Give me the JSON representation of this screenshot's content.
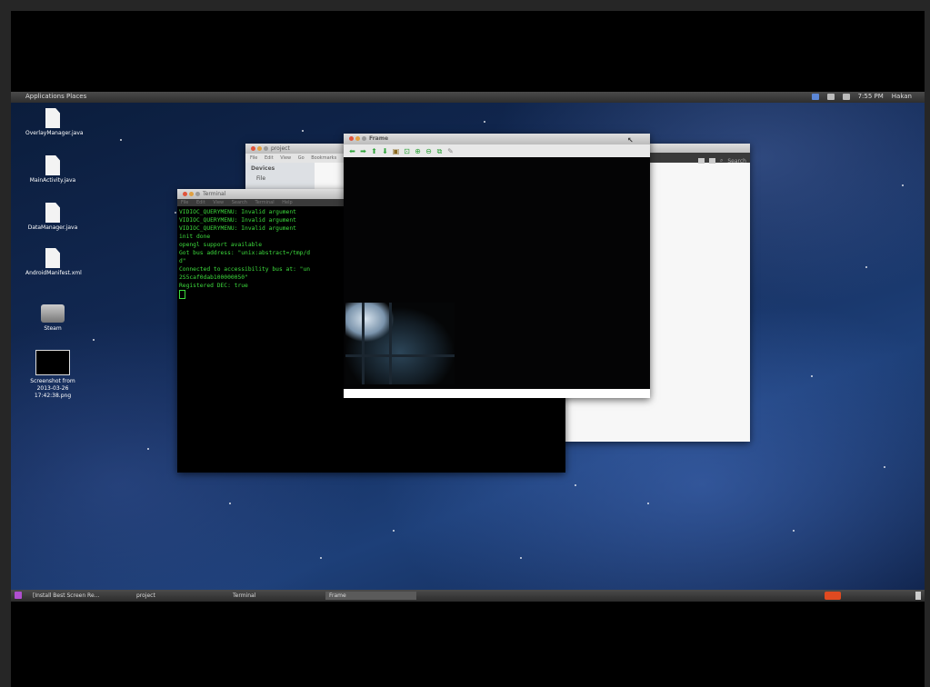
{
  "top_panel": {
    "menu": "Applications Places",
    "clock": "7:55 PM",
    "user": "Hakan"
  },
  "desktop_icons": [
    {
      "label": "OverlayManager.java",
      "icon": "java-file-icon"
    },
    {
      "label": "MainActivity.java",
      "icon": "java-file-icon"
    },
    {
      "label": "DataManager.java",
      "icon": "java-file-icon"
    },
    {
      "label": "AndroidManifest.xml",
      "icon": "xml-file-icon"
    },
    {
      "label": "Steam",
      "icon": "steam-icon"
    },
    {
      "label": "Screenshot from 2013-03-26 17:42:38.png",
      "icon": "image-file-icon"
    }
  ],
  "project_window": {
    "title": "project",
    "menu": [
      "File",
      "Edit",
      "View",
      "Go",
      "Bookmarks"
    ],
    "side_header": "Devices",
    "side_items": [
      "File"
    ],
    "search_label": "Search"
  },
  "terminal_window": {
    "title": "Terminal",
    "menu": [
      "File",
      "Edit",
      "View",
      "Search",
      "Terminal",
      "Help"
    ],
    "lines": [
      "VIDIOC_QUERYMENU: Invalid argument",
      "VIDIOC_QUERYMENU: Invalid argument",
      "VIDIOC_QUERYMENU: Invalid argument",
      "init done",
      "opengl support available",
      "Got bus address: \"unix:abstract=/tmp/d",
      "d\"",
      "Connected to accessibility bus at: \"un",
      "2S5caf0dab100000050\"",
      "Registered DEC: true"
    ]
  },
  "frame_window": {
    "title": "Frame",
    "tools": [
      "back-icon",
      "forward-icon",
      "up-icon",
      "down-icon",
      "save-icon",
      "zoom-fit-icon",
      "zoom-in-icon",
      "zoom-out-icon",
      "zoom-reset-icon",
      "pin-icon"
    ]
  },
  "bottom_panel": {
    "tasks": [
      "[Install Best Screen Re...",
      "project",
      "Terminal",
      "Frame"
    ]
  },
  "colors": {
    "terminal_text": "#3ddc3d",
    "panel": "#3a3a3a",
    "accent_red": "#e0543c"
  }
}
